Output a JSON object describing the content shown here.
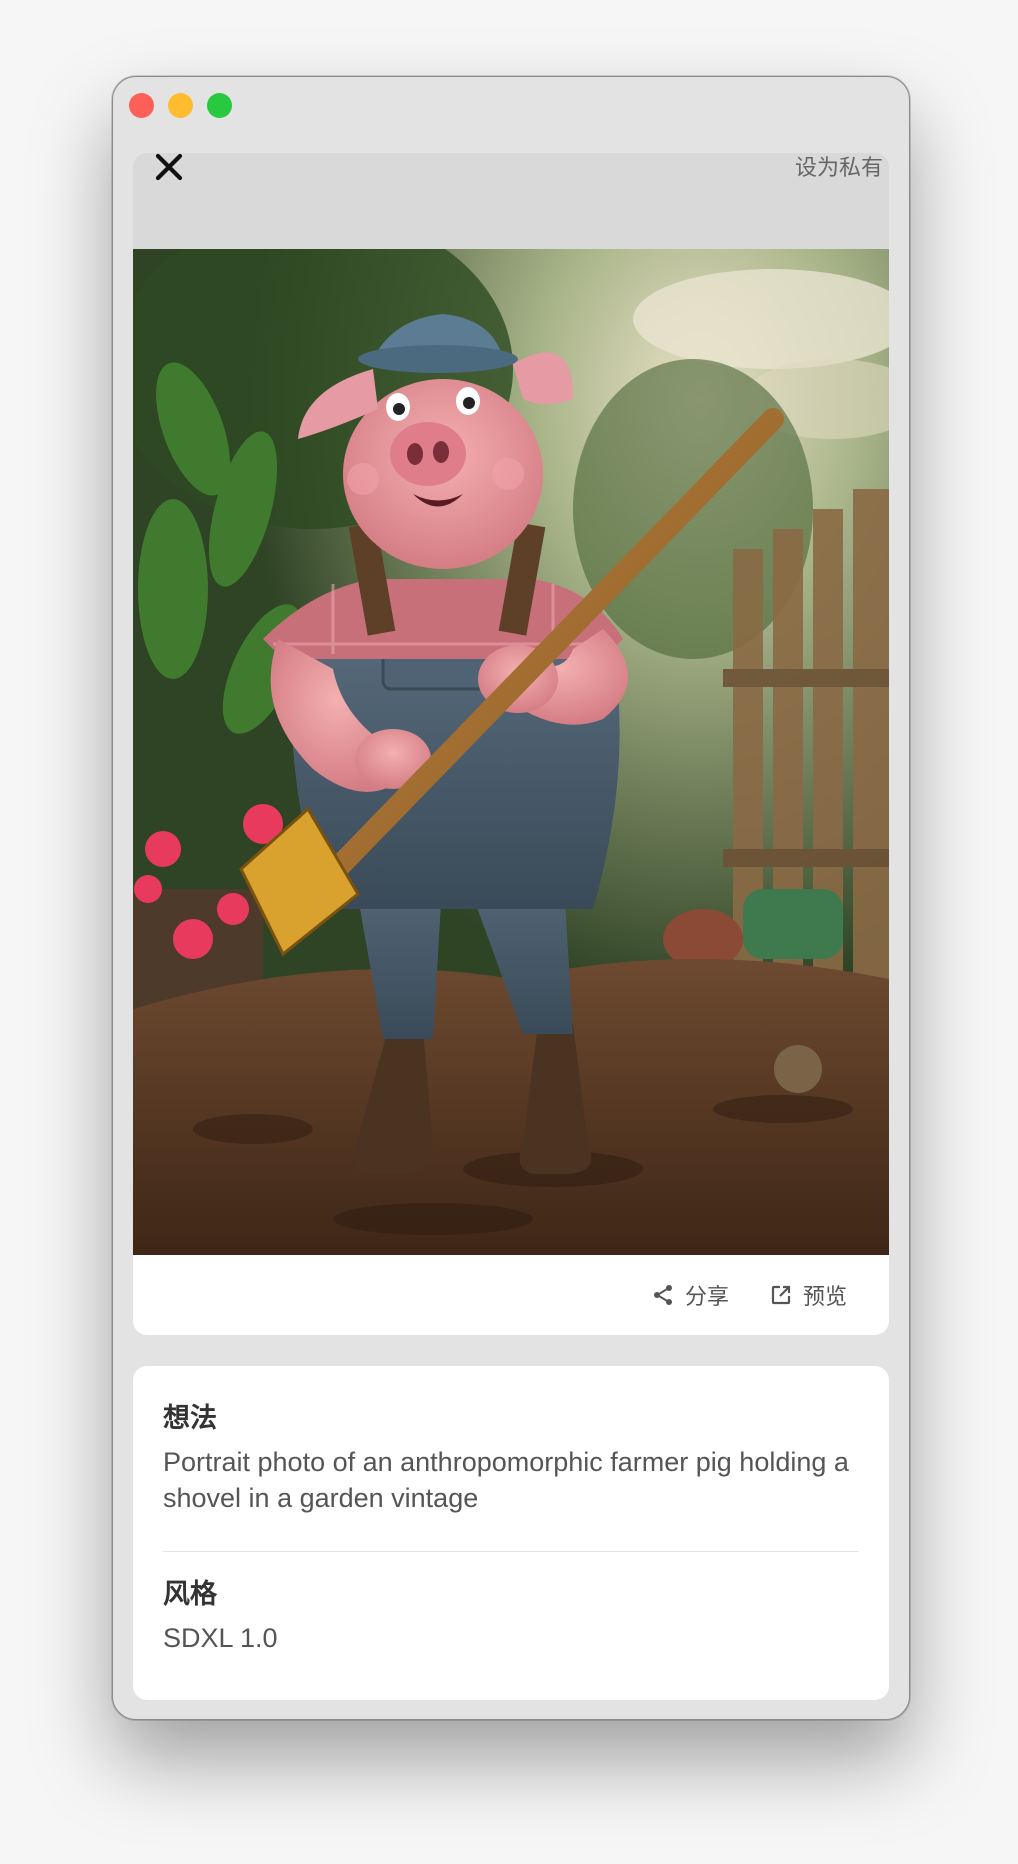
{
  "window": {
    "controls": [
      "close",
      "minimize",
      "zoom"
    ]
  },
  "header": {
    "make_private": "设为私有"
  },
  "image": {
    "alt_subject": "anthropomorphic farmer pig holding a shovel in a garden"
  },
  "actions": {
    "share": "分享",
    "preview": "预览"
  },
  "details": {
    "idea_label": "想法",
    "idea_text": "Portrait photo of an anthropomorphic farmer pig holding a shovel in a garden vintage",
    "style_label": "风格",
    "style_value": "SDXL 1.0"
  },
  "colors": {
    "accent_red": "#fe5f57",
    "accent_yellow": "#febc2e",
    "accent_green": "#28c840"
  }
}
